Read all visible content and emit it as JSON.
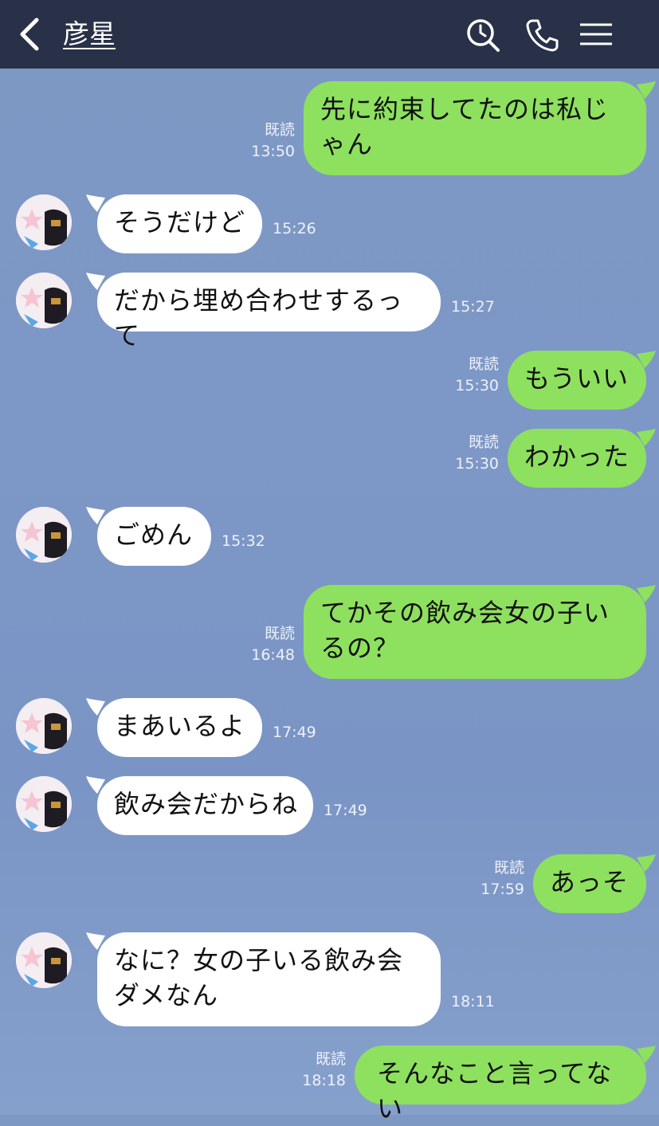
{
  "header": {
    "title": "彦星"
  },
  "messages": [
    {
      "side": "sent",
      "text": "先に約束してたのは私じゃん",
      "read": "既読",
      "time": "13:50"
    },
    {
      "side": "recv",
      "text": "そうだけど",
      "time": "15:26"
    },
    {
      "side": "recv",
      "text": "だから埋め合わせするって",
      "time": "15:27"
    },
    {
      "side": "sent",
      "text": "もういい",
      "read": "既読",
      "time": "15:30"
    },
    {
      "side": "sent",
      "text": "わかった",
      "read": "既読",
      "time": "15:30"
    },
    {
      "side": "recv",
      "text": "ごめん",
      "time": "15:32"
    },
    {
      "side": "sent",
      "text": "てかその飲み会女の子いるの？",
      "read": "既読",
      "time": "16:48"
    },
    {
      "side": "recv",
      "text": "まあいるよ",
      "time": "17:49"
    },
    {
      "side": "recv",
      "text": "飲み会だからね",
      "time": "17:49"
    },
    {
      "side": "sent",
      "text": "あっそ",
      "read": "既読",
      "time": "17:59"
    },
    {
      "side": "recv",
      "text": "なに？女の子いる飲み会ダメなん",
      "time": "18:11"
    },
    {
      "side": "sent",
      "text": "そんなこと言ってない",
      "read": "既読",
      "time": "18:18"
    }
  ],
  "colors": {
    "header": "#283148",
    "sent_bubble": "#8ee05f",
    "recv_bubble": "#ffffff",
    "background": "#7e98c4"
  },
  "icons": [
    "back-arrow-icon",
    "search-icon",
    "phone-icon",
    "menu-icon",
    "avatar"
  ]
}
